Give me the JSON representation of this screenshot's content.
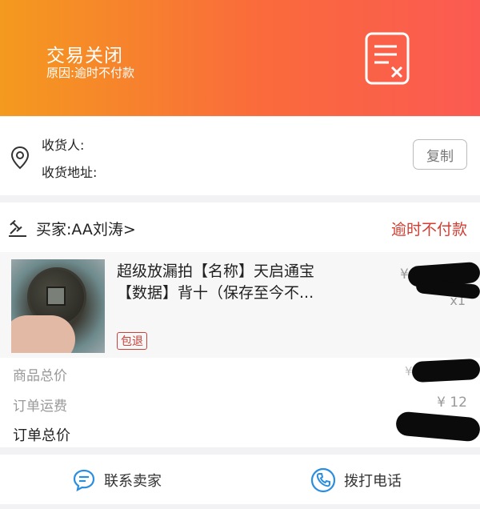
{
  "header": {
    "title": "交易关闭",
    "reason": "原因:逾时不付款"
  },
  "address": {
    "receiver_label": "收货人:",
    "address_label": "收货地址:",
    "copy_label": "复制"
  },
  "order": {
    "buyer_label": "买家:AA刘涛>",
    "status": "逾时不付款",
    "item": {
      "title_line1": "超级放漏拍【名称】天启通宝",
      "title_line2": "【数据】背十（保存至今不...",
      "tag": "包退",
      "price_mark": "¥",
      "quantity": "x1"
    },
    "summary": {
      "goods_total_label": "商品总价",
      "goods_total_mark": "¥",
      "shipping_label": "订单运费",
      "shipping_value": "¥ 12",
      "order_total_label": "订单总价"
    }
  },
  "footer": {
    "contact_seller": "联系卖家",
    "call_phone": "拨打电话"
  },
  "colors": {
    "header_gradient_start": "#f49a1e",
    "header_gradient_end": "#fb5a52",
    "status_red": "#d23d32",
    "icon_blue": "#2a8ee0"
  }
}
